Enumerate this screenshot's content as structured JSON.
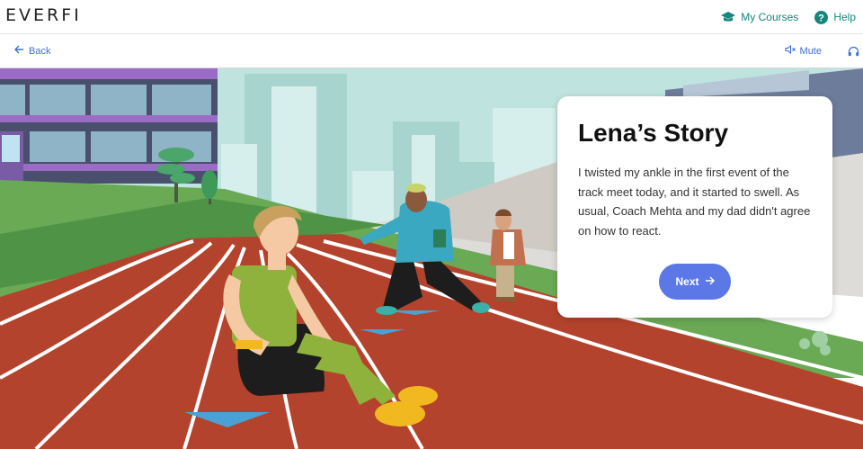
{
  "header": {
    "logo": "EVERFI",
    "my_courses": "My Courses",
    "help": "Help"
  },
  "subnav": {
    "back": "Back",
    "mute": "Mute"
  },
  "card": {
    "title": "Lena’s Story",
    "body": "I twisted my ankle in the first event of the track meet today, and it started to swell.  As usual, Coach Mehta and my dad didn't agree on how to react.",
    "next": "Next"
  },
  "colors": {
    "accent_teal": "#16867d",
    "link_blue": "#3f6fd6",
    "button_blue": "#5b78e6",
    "track_red": "#b3432c"
  },
  "icons": [
    "graduation-cap-icon",
    "help-circle-icon",
    "arrow-left-icon",
    "speaker-mute-icon",
    "headphones-icon",
    "arrow-right-icon"
  ]
}
